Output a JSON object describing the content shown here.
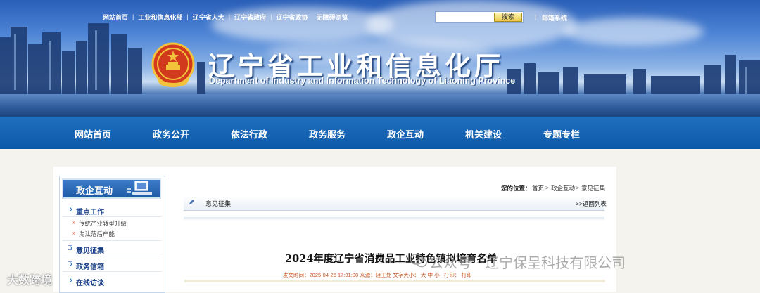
{
  "top_links": [
    "网站首页",
    "工业和信息化部",
    "辽宁省人大",
    "辽宁省政府",
    "辽宁省政协",
    "无障碍浏览"
  ],
  "search": {
    "button": "搜索",
    "placeholder": ""
  },
  "mail_link": "邮箱系统",
  "site": {
    "title": "辽宁省工业和信息化厅",
    "subtitle": "Department of Industry and Information Technology of Liaoning Province"
  },
  "nav": [
    "网站首页",
    "政务公开",
    "依法行政",
    "政务服务",
    "政企互动",
    "机关建设",
    "专题专栏"
  ],
  "sidebar": {
    "title": "政企互动",
    "items": [
      {
        "label": "重点工作",
        "type": "main"
      },
      {
        "label": "传统产业转型升级",
        "type": "sub"
      },
      {
        "label": "淘汰落后产能",
        "type": "sub"
      },
      {
        "label": "意见征集",
        "type": "main"
      },
      {
        "label": "政务信箱",
        "type": "main"
      },
      {
        "label": "在线访谈",
        "type": "main"
      }
    ]
  },
  "breadcrumb": {
    "label": "您的位置：",
    "items": [
      "首页",
      "政企互动",
      "意见征集"
    ],
    "sep": ">"
  },
  "section": {
    "label": "意见征集",
    "back": ">>返回列表"
  },
  "article": {
    "title": "2024年度辽宁省消费品工业特色镇拟培育名单",
    "meta_date": "发文时间：2025-04-25 17:01:00",
    "meta_source": "来源：轻工处",
    "meta_font": "文字大小：",
    "font_sizes": [
      "大",
      "中",
      "小"
    ],
    "print": "打印：",
    "print_link": "打印"
  },
  "watermark": {
    "text": "公众号 · 辽宁保呈科技有限公司",
    "corner": "大数跨境"
  }
}
